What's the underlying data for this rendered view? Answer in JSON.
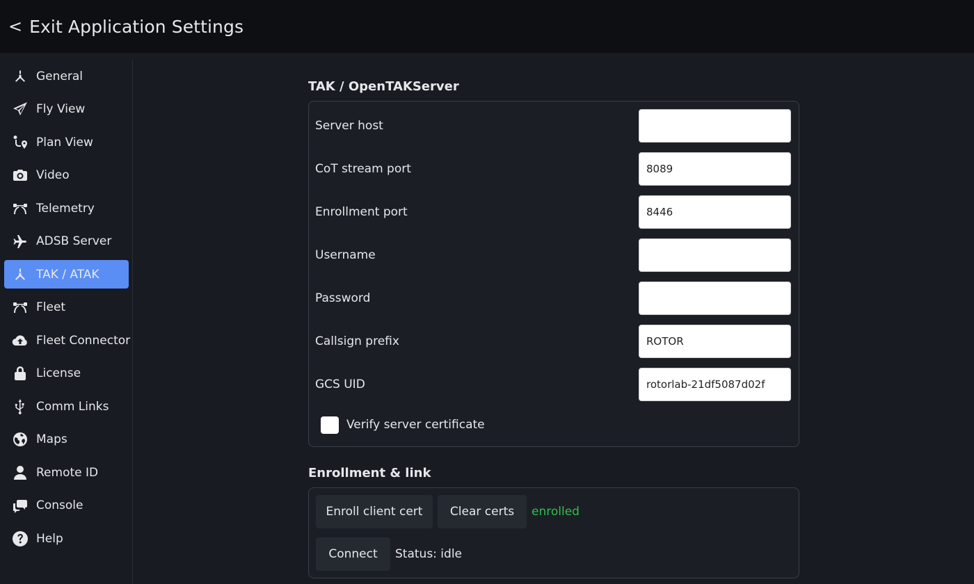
{
  "header": {
    "back_glyph": "<",
    "title": "Exit Application Settings"
  },
  "sidebar": {
    "active_color": "#5a8ef5",
    "items": [
      {
        "label": "General",
        "icon": "drone-icon"
      },
      {
        "label": "Fly View",
        "icon": "paper-plane-icon"
      },
      {
        "label": "Plan View",
        "icon": "route-pin-icon"
      },
      {
        "label": "Video",
        "icon": "camera-icon"
      },
      {
        "label": "Telemetry",
        "icon": "bezier-curve-icon"
      },
      {
        "label": "ADSB Server",
        "icon": "airplane-icon"
      },
      {
        "label": "TAK / ATAK",
        "icon": "drone-icon",
        "active": true
      },
      {
        "label": "Fleet",
        "icon": "bezier-curve-icon"
      },
      {
        "label": "Fleet Connector",
        "icon": "cloud-upload-icon"
      },
      {
        "label": "License",
        "icon": "lock-icon"
      },
      {
        "label": "Comm Links",
        "icon": "usb-icon"
      },
      {
        "label": "Maps",
        "icon": "globe-icon"
      },
      {
        "label": "Remote ID",
        "icon": "user-icon"
      },
      {
        "label": "Console",
        "icon": "comments-icon"
      },
      {
        "label": "Help",
        "icon": "question-circle-icon"
      }
    ]
  },
  "tak_section": {
    "title": "TAK / OpenTAKServer",
    "fields": {
      "server_host": {
        "label": "Server host",
        "value": ""
      },
      "cot_port": {
        "label": "CoT stream port",
        "value": "8089"
      },
      "enroll_port": {
        "label": "Enrollment port",
        "value": "8446"
      },
      "username": {
        "label": "Username",
        "value": ""
      },
      "password": {
        "label": "Password",
        "value": ""
      },
      "callsign": {
        "label": "Callsign prefix",
        "value": "ROTOR"
      },
      "gcs_uid": {
        "label": "GCS UID",
        "value": "rotorlab-21df5087d02f"
      }
    },
    "verify_cert": {
      "label": "Verify server certificate",
      "checked": false
    }
  },
  "enroll_section": {
    "title": "Enrollment & link",
    "enroll_button": "Enroll client cert",
    "clear_button": "Clear certs",
    "enroll_state": "enrolled",
    "enroll_state_color": "#2fbf4d",
    "connect_button": "Connect",
    "status_text": "Status: idle"
  }
}
